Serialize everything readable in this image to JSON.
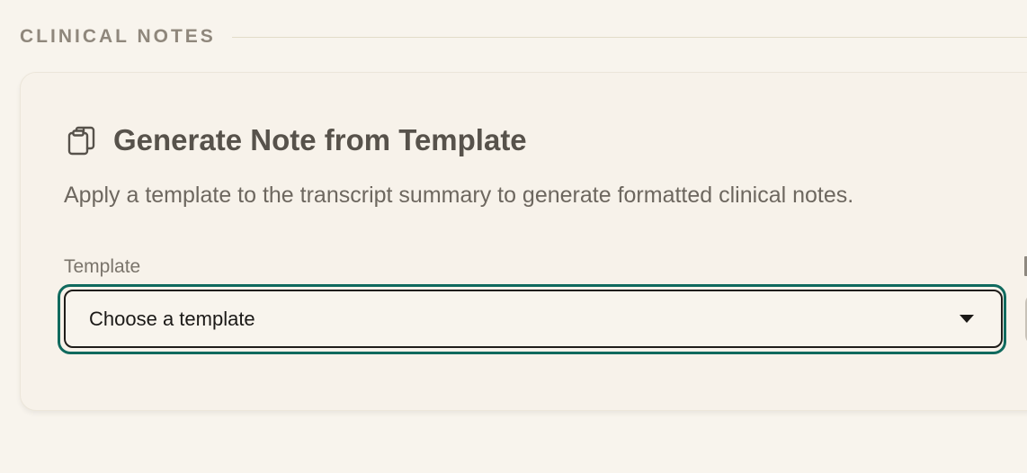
{
  "section": {
    "title": "CLINICAL NOTES"
  },
  "card": {
    "icon": "clipboard-icon",
    "title": "Generate Note from Template",
    "description": "Apply a template to the transcript summary to generate formatted clinical notes."
  },
  "template_field": {
    "label": "Template",
    "selected_value": "Choose a template",
    "caret_icon": "caret-down-icon"
  },
  "colors": {
    "background": "#f8f4ed",
    "focus_ring": "#106a5e",
    "title_text": "#57524b"
  }
}
